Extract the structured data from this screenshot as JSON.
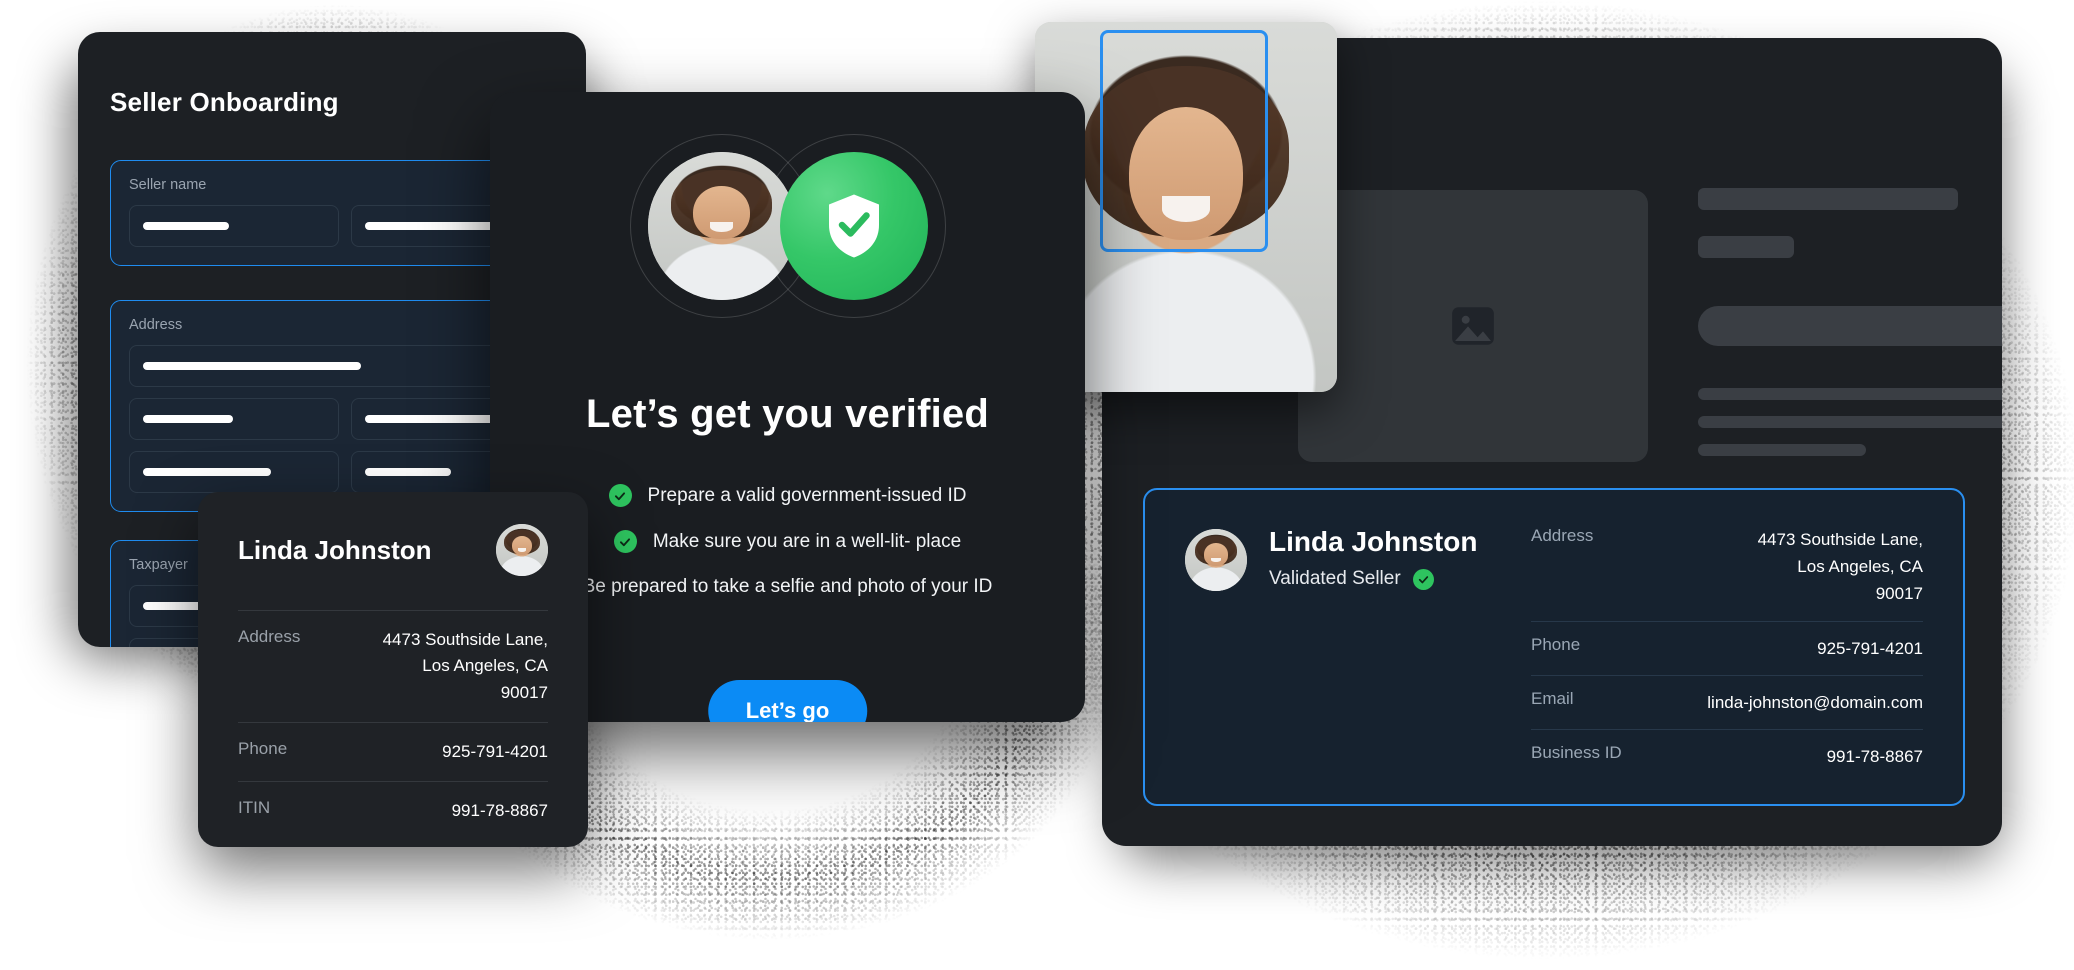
{
  "onboarding": {
    "title": "Seller Onboarding",
    "groups": [
      {
        "label": "Seller name",
        "name": "seller-name-group"
      },
      {
        "label": "Address",
        "name": "address-group"
      },
      {
        "label": "Taxpayer",
        "name": "taxpayer-group"
      }
    ]
  },
  "verify_modal": {
    "heading": "Let’s get you verified",
    "checklist": [
      "Prepare a valid government-issued ID",
      "Make sure you are in a well-lit- place"
    ],
    "note": "Be prepared to take a selfie and photo of your ID",
    "cta_label": "Let’s go",
    "avatar_icon": "user-avatar-photo",
    "shield_icon": "shield-check-icon",
    "check_icon": "check-circle-icon"
  },
  "seller_card": {
    "name": "Linda Johnston",
    "avatar_icon": "user-avatar-photo",
    "rows": [
      {
        "key": "Address",
        "value": "4473 Southside Lane,\nLos Angeles, CA\n90017"
      },
      {
        "key": "Phone",
        "value": "925-791-4201"
      },
      {
        "key": "ITIN",
        "value": "991-78-8867"
      }
    ]
  },
  "right_panel": {
    "selfie_icon": "selfie-photo",
    "face_box_icon": "face-detection-box",
    "image_placeholder_icon": "image-placeholder-icon",
    "validated_card": {
      "name": "Linda Johnston",
      "status": "Validated Seller",
      "status_icon": "verified-check-icon",
      "avatar_icon": "user-avatar-photo",
      "rows": [
        {
          "key": "Address",
          "value": "4473 Southside Lane,\nLos Angeles, CA\n90017"
        },
        {
          "key": "Phone",
          "value": "925-791-4201"
        },
        {
          "key": "Email",
          "value": "linda-johnston@domain.com"
        },
        {
          "key": "Business ID",
          "value": "991-78-8867"
        }
      ]
    }
  },
  "colors": {
    "accent_blue": "#2a8ff0",
    "cta_blue": "#0b8bf5",
    "success_green": "#2ec45f",
    "panel_bg": "#1d2024",
    "modal_bg": "#1a1d21",
    "field_bg": "#1b2634",
    "validated_card_bg": "#16222f"
  }
}
